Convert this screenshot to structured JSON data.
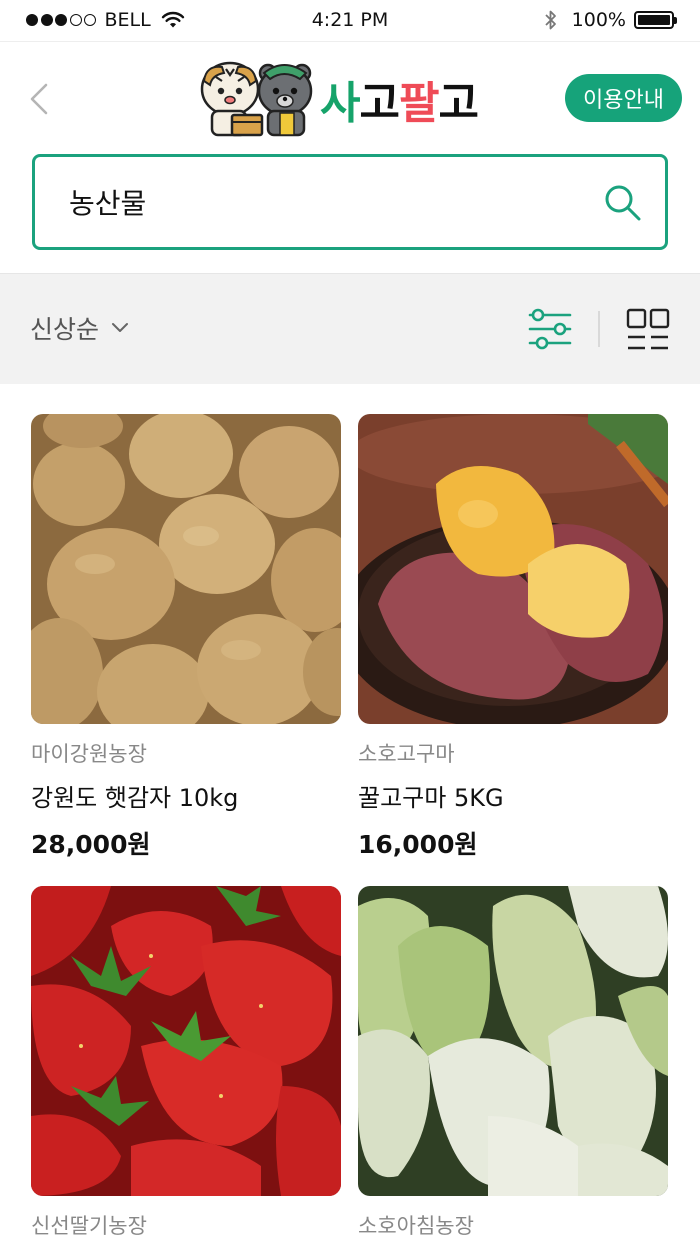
{
  "status_bar": {
    "carrier": "BELL",
    "time": "4:21 PM",
    "battery": "100%",
    "battery_level": 1.0,
    "signal_bars_filled": 3,
    "signal_bars_total": 5
  },
  "header": {
    "logo_text": [
      "사",
      "고",
      "팔",
      "고"
    ],
    "guide_button_label": "이용안내"
  },
  "search": {
    "value": "농산물"
  },
  "toolbar": {
    "sort_label": "신상순"
  },
  "products": [
    {
      "seller": "마이강원농장",
      "name": "강원도 햇감자 10kg",
      "price": "28,000원",
      "image": "potatoes"
    },
    {
      "seller": "소호고구마",
      "name": "꿀고구마 5KG",
      "price": "16,000원",
      "image": "sweet-potatoes"
    },
    {
      "seller": "신선딸기농장",
      "name": "",
      "price": "",
      "image": "strawberries"
    },
    {
      "seller": "소호아침농장",
      "name": "",
      "price": "",
      "image": "radishes"
    }
  ],
  "colors": {
    "accent": "#16a37a",
    "search_border": "#1ba27e",
    "logo_green": "#16a36a",
    "logo_red": "#ef4b57",
    "toolbar_bg": "#f2f2f2"
  }
}
